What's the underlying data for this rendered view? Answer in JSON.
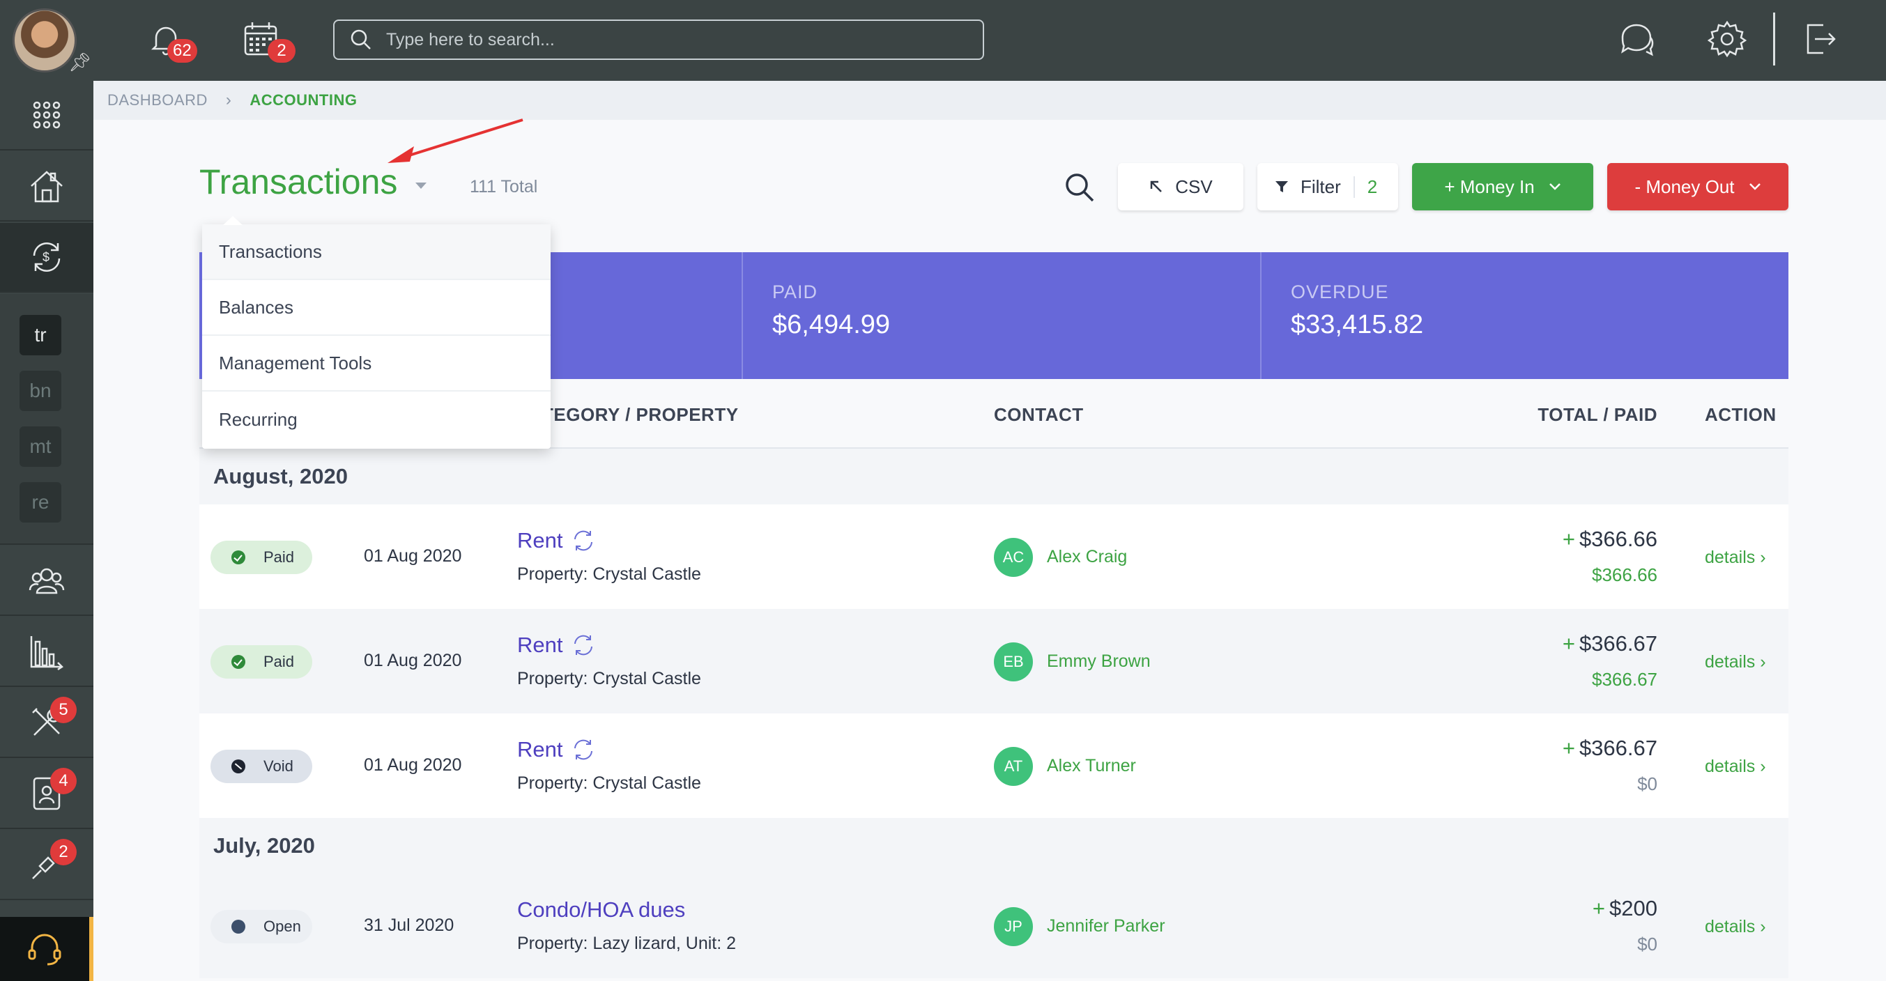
{
  "topbar": {
    "notifications_count": "62",
    "calendar_count": "2",
    "search_placeholder": "Type here to search..."
  },
  "sidebar": {
    "sub_items": [
      "tr",
      "bn",
      "mt",
      "re"
    ],
    "badges": {
      "maintenance": "5",
      "tenants": "4",
      "tools": "2"
    }
  },
  "breadcrumb": {
    "root": "DASHBOARD",
    "current": "ACCOUNTING"
  },
  "page": {
    "title": "Transactions",
    "total": "111 Total",
    "csv_label": "CSV",
    "filter_label": "Filter",
    "filter_count": "2",
    "money_in_label": "+ Money In",
    "money_out_label": "- Money Out"
  },
  "dropdown": {
    "items": [
      "Transactions",
      "Balances",
      "Management Tools",
      "Recurring"
    ]
  },
  "stats": {
    "paid_label": "PAID",
    "paid_value": "$6,494.99",
    "overdue_label": "OVERDUE",
    "overdue_value": "$33,415.82"
  },
  "table": {
    "headers": {
      "category": "TEGORY / PROPERTY",
      "contact": "CONTACT",
      "total": "TOTAL / PAID",
      "action": "ACTION"
    },
    "groups": [
      {
        "month": "August, 2020",
        "rows": [
          {
            "status": "Paid",
            "date": "01 Aug 2020",
            "category": "Rent",
            "property": "Property: Crystal Castle",
            "initials": "AC",
            "contact": "Alex Craig",
            "total": "$366.66",
            "paid": "$366.66",
            "action": "details"
          },
          {
            "status": "Paid",
            "date": "01 Aug 2020",
            "category": "Rent",
            "property": "Property: Crystal Castle",
            "initials": "EB",
            "contact": "Emmy Brown",
            "total": "$366.67",
            "paid": "$366.67",
            "action": "details"
          },
          {
            "status": "Void",
            "date": "01 Aug 2020",
            "category": "Rent",
            "property": "Property: Crystal Castle",
            "initials": "AT",
            "contact": "Alex Turner",
            "total": "$366.67",
            "paid": "$0",
            "action": "details"
          }
        ]
      },
      {
        "month": "July, 2020",
        "rows": [
          {
            "status": "Open",
            "date": "31 Jul 2020",
            "category": "Condo/HOA dues",
            "property": "Property: Lazy lizard, Unit: 2",
            "initials": "JP",
            "contact": "Jennifer Parker",
            "total": "$200",
            "paid": "$0",
            "action": "details"
          }
        ]
      }
    ],
    "plus_sign": "+",
    "chevron": "›"
  },
  "colors": {
    "brand_green": "#3da343",
    "stats_purple": "#6768d9",
    "money_out_red": "#dd3d3d",
    "sidebar": "#3b4444"
  }
}
